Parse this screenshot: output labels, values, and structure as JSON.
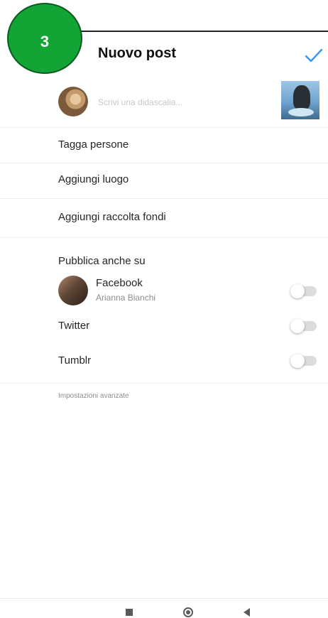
{
  "step": {
    "number": "3"
  },
  "header": {
    "title": "Nuovo post",
    "confirm_icon": "check-icon",
    "accent_color": "#3897f0"
  },
  "caption": {
    "placeholder": "Scrivi una didascalia..."
  },
  "menu": {
    "tag_people": "Tagga persone",
    "add_location": "Aggiungi luogo",
    "add_fundraiser": "Aggiungi raccolta fondi"
  },
  "share": {
    "heading": "Pubblica anche su",
    "facebook": {
      "name": "Facebook",
      "account": "Arianna Bianchi",
      "enabled": false
    },
    "twitter": {
      "name": "Twitter",
      "enabled": false
    },
    "tumblr": {
      "name": "Tumblr",
      "enabled": false
    }
  },
  "advanced_settings": "Impostazioni avanzate",
  "navbar": {
    "icons": [
      "recent-apps-icon",
      "home-icon",
      "back-icon"
    ]
  }
}
